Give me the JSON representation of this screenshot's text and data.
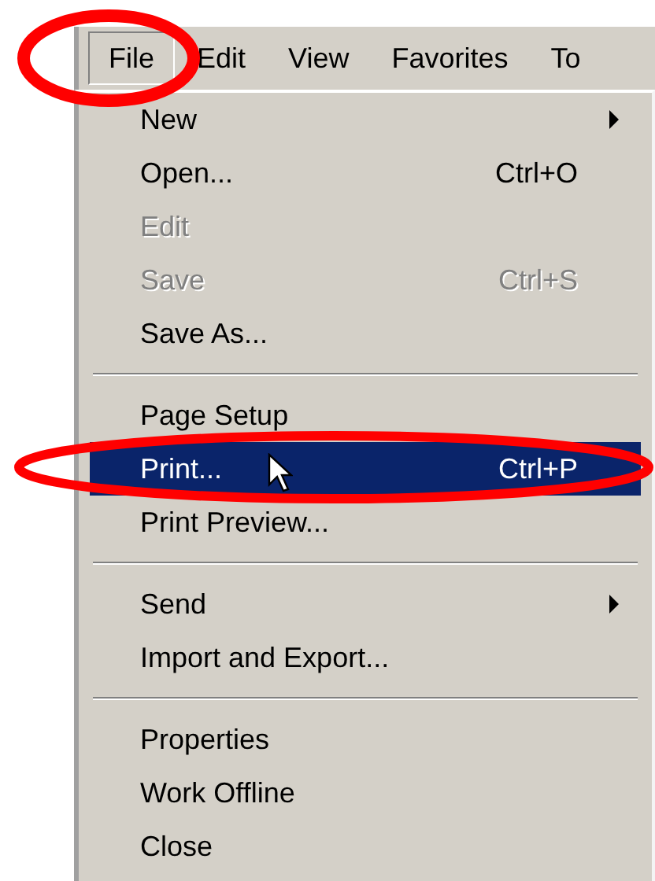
{
  "menu_bar": [
    {
      "label": "File",
      "selected": true
    },
    {
      "label": "Edit",
      "selected": false
    },
    {
      "label": "View",
      "selected": false
    },
    {
      "label": "Favorites",
      "selected": false
    },
    {
      "label": "To",
      "selected": false
    }
  ],
  "menu": [
    {
      "kind": "item",
      "label": "New",
      "submenu": true,
      "disabled": false,
      "selected": false
    },
    {
      "kind": "item",
      "label": "Open...",
      "shortcut": "Ctrl+O",
      "submenu": false,
      "disabled": false,
      "selected": false
    },
    {
      "kind": "item",
      "label": "Edit",
      "submenu": false,
      "disabled": true,
      "selected": false
    },
    {
      "kind": "item",
      "label": "Save",
      "shortcut": "Ctrl+S",
      "submenu": false,
      "disabled": true,
      "selected": false
    },
    {
      "kind": "item",
      "label": "Save As...",
      "submenu": false,
      "disabled": false,
      "selected": false
    },
    {
      "kind": "separator"
    },
    {
      "kind": "item",
      "label": "Page Setup",
      "submenu": false,
      "disabled": false,
      "selected": false
    },
    {
      "kind": "item",
      "label": "Print...",
      "shortcut": "Ctrl+P",
      "submenu": false,
      "disabled": false,
      "selected": true
    },
    {
      "kind": "item",
      "label": "Print Preview...",
      "submenu": false,
      "disabled": false,
      "selected": false
    },
    {
      "kind": "separator"
    },
    {
      "kind": "item",
      "label": "Send",
      "submenu": true,
      "disabled": false,
      "selected": false
    },
    {
      "kind": "item",
      "label": "Import and Export...",
      "submenu": false,
      "disabled": false,
      "selected": false
    },
    {
      "kind": "separator"
    },
    {
      "kind": "item",
      "label": "Properties",
      "submenu": false,
      "disabled": false,
      "selected": false
    },
    {
      "kind": "item",
      "label": "Work Offline",
      "submenu": false,
      "disabled": false,
      "selected": false
    },
    {
      "kind": "item",
      "label": "Close",
      "submenu": false,
      "disabled": false,
      "selected": false
    }
  ]
}
